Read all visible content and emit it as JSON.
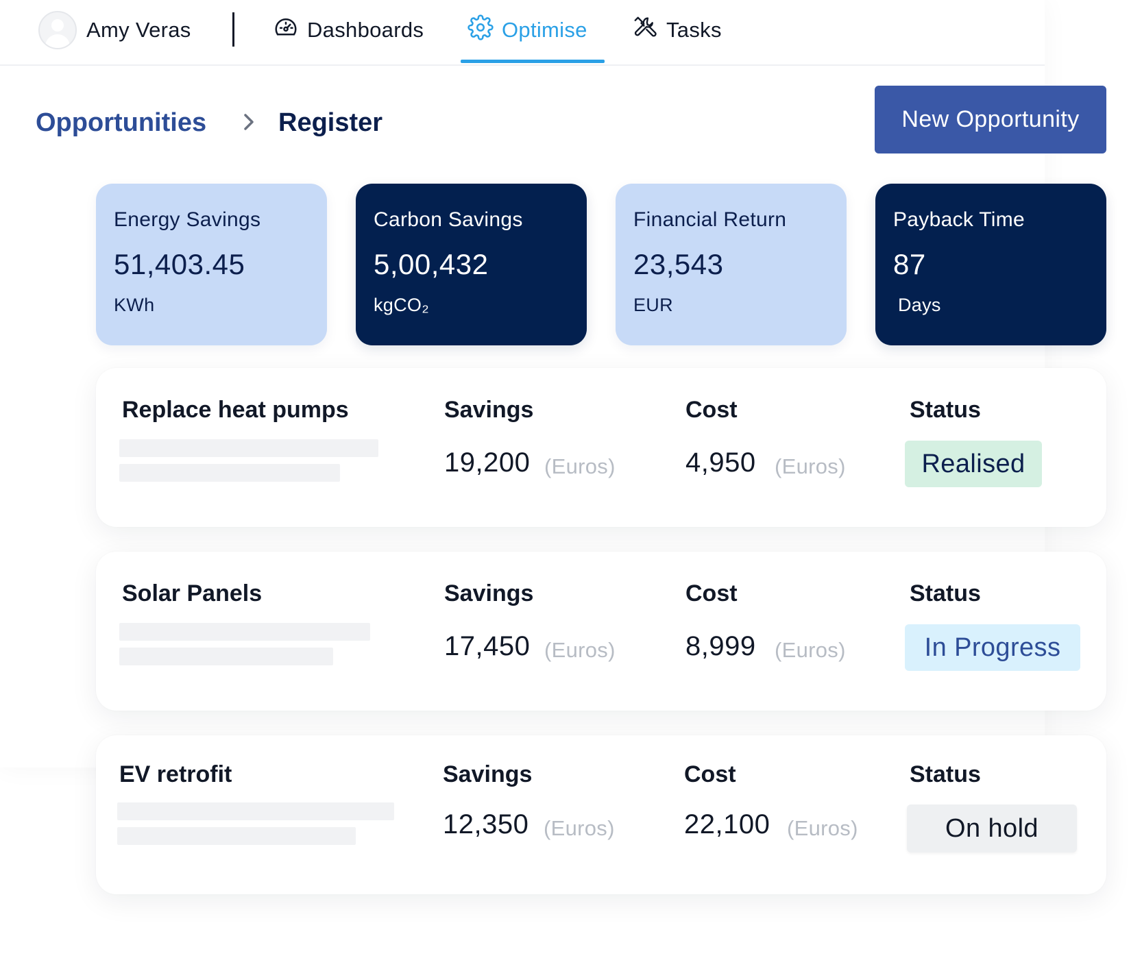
{
  "nav": {
    "user_name": "Amy Veras",
    "items": [
      {
        "label": "Dashboards",
        "icon": "gauge-icon"
      },
      {
        "label": "Optimise",
        "icon": "gear-icon",
        "active": true
      },
      {
        "label": "Tasks",
        "icon": "tools-icon"
      }
    ]
  },
  "breadcrumb": {
    "root": "Opportunities",
    "current": "Register"
  },
  "actions": {
    "new_opportunity": "New Opportunity"
  },
  "metrics": [
    {
      "label": "Energy Savings",
      "value": "51,403.45",
      "unit": "KWh",
      "theme": "light"
    },
    {
      "label": "Carbon Savings",
      "value": "5,00,432",
      "unit": "kgCO₂",
      "theme": "dark"
    },
    {
      "label": "Financial Return",
      "value": "23,543",
      "unit": "EUR",
      "theme": "light"
    },
    {
      "label": "Payback Time",
      "value": "87",
      "unit": "Days",
      "theme": "dark"
    }
  ],
  "opportunities": [
    {
      "title": "Replace heat pumps",
      "savings_header": "Savings",
      "savings": "19,200",
      "savings_unit": "(Euros)",
      "cost_header": "Cost",
      "cost": "4,950",
      "cost_unit": "(Euros)",
      "status_header": "Status",
      "status": "Realised"
    },
    {
      "title": "Solar Panels",
      "savings_header": "Savings",
      "savings": "17,450",
      "savings_unit": "(Euros)",
      "cost_header": "Cost",
      "cost": "8,999",
      "cost_unit": "(Euros)",
      "status_header": "Status",
      "status": "In Progress"
    },
    {
      "title": "EV retrofit",
      "savings_header": "Savings",
      "savings": "12,350",
      "savings_unit": "(Euros)",
      "cost_header": "Cost",
      "cost": "22,100",
      "cost_unit": "(Euros)",
      "status_header": "Status",
      "status": "On hold"
    }
  ],
  "colors": {
    "accent": "#2aa0e6",
    "primary_button": "#3a58a7",
    "card_light": "#c7daf7",
    "card_dark": "#03204f",
    "status_realised": "#d5f0e2",
    "status_in_progress": "#d9f1fd",
    "status_on_hold": "#eef0f2"
  }
}
